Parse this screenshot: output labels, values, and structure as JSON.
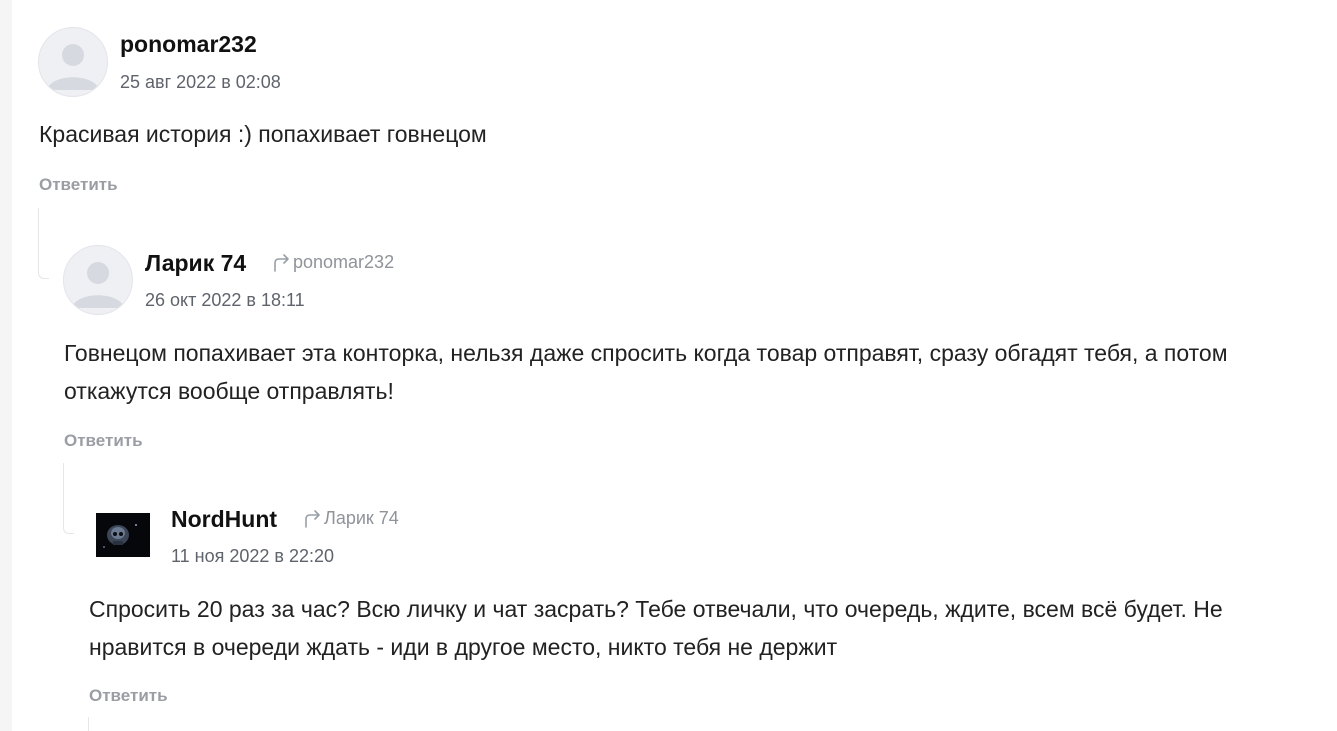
{
  "comments": [
    {
      "author": "ponomar232",
      "reply_to": "",
      "date": "25 авг 2022 в 02:08",
      "text": "Красивая история :) попахивает говнецом",
      "reply_label": "Ответить",
      "avatar": "default-user-icon"
    },
    {
      "author": "Ларик 74",
      "reply_to": "ponomar232",
      "date": "26 окт 2022 в 18:11",
      "text": "Говнецом попахивает эта конторка, нельзя даже спросить когда товар отправят, сразу обгадят тебя, а потом откажутся вообще отправлять!",
      "reply_label": "Ответить",
      "avatar": "default-user-icon"
    },
    {
      "author": "NordHunt",
      "reply_to": "Ларик 74",
      "date": "11 ноя 2022 в 22:20",
      "text": "Спросить 20 раз за час? Всю личку и чат засрать? Тебе отвечали, что очередь, ждите, всем всё будет. Не нравится в очереди ждать - иди в другое место, никто тебя не держит",
      "reply_label": "Ответить",
      "avatar": "dark-skull-image"
    }
  ],
  "colors": {
    "author": "#111111",
    "date": "#5f636b",
    "reply_link": "#9a9da3",
    "reply_to": "#8f939a",
    "thread_line": "#e6e6ea"
  }
}
